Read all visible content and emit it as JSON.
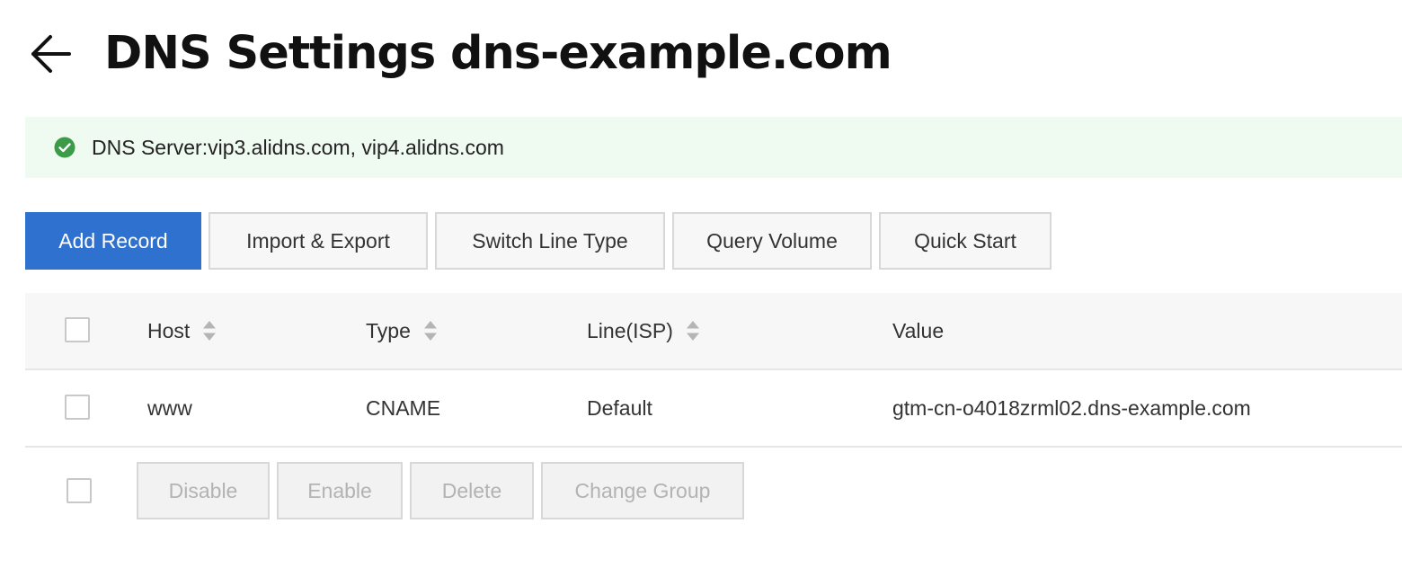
{
  "header": {
    "back_icon": "arrow-left-icon",
    "title": "DNS Settings dns-example.com"
  },
  "notice": {
    "icon": "check-circle-icon",
    "text": "DNS Server:vip3.alidns.com, vip4.alidns.com",
    "icon_color": "#3b9b48",
    "background": "#effaf1"
  },
  "toolbar": {
    "add_record": "Add Record",
    "import_export": "Import & Export",
    "switch_line_type": "Switch Line Type",
    "query_volume": "Query Volume",
    "quick_start": "Quick Start",
    "primary_color": "#2f71cf"
  },
  "table": {
    "columns": {
      "host": "Host",
      "type": "Type",
      "line": "Line(ISP)",
      "value": "Value"
    },
    "rows": [
      {
        "host": "www",
        "type": "CNAME",
        "line": "Default",
        "value": "gtm-cn-o4018zrml02.dns-example.com"
      }
    ]
  },
  "batch": {
    "disable": "Disable",
    "enable": "Enable",
    "delete": "Delete",
    "change_group": "Change Group"
  }
}
